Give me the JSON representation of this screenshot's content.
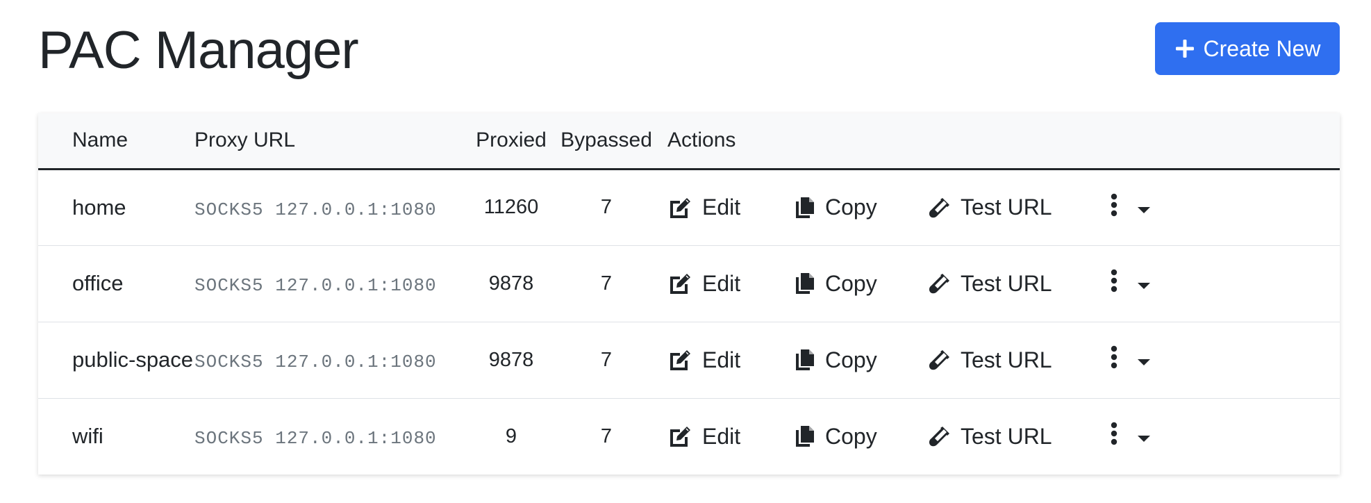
{
  "page": {
    "title": "PAC Manager",
    "create_button_label": "Create New"
  },
  "colors": {
    "primary": "#2f6ff0",
    "text": "#212529",
    "muted": "#6c757d",
    "header_bg": "#f8f9fa"
  },
  "table": {
    "headers": {
      "name": "Name",
      "proxy_url": "Proxy URL",
      "proxied": "Proxied",
      "bypassed": "Bypassed",
      "actions": "Actions"
    },
    "action_labels": {
      "edit": "Edit",
      "copy": "Copy",
      "test": "Test URL"
    },
    "icons": {
      "edit": "edit-icon",
      "copy": "copy-icon",
      "test": "test-tube-icon",
      "more": "more-vertical-icon",
      "dropdown": "caret-down-icon"
    },
    "rows": [
      {
        "name": "home",
        "proxy_url": "SOCKS5 127.0.0.1:1080",
        "proxied": "11260",
        "bypassed": "7"
      },
      {
        "name": "office",
        "proxy_url": "SOCKS5 127.0.0.1:1080",
        "proxied": "9878",
        "bypassed": "7"
      },
      {
        "name": "public-space",
        "proxy_url": "SOCKS5 127.0.0.1:1080",
        "proxied": "9878",
        "bypassed": "7"
      },
      {
        "name": "wifi",
        "proxy_url": "SOCKS5 127.0.0.1:1080",
        "proxied": "9",
        "bypassed": "7"
      }
    ]
  }
}
